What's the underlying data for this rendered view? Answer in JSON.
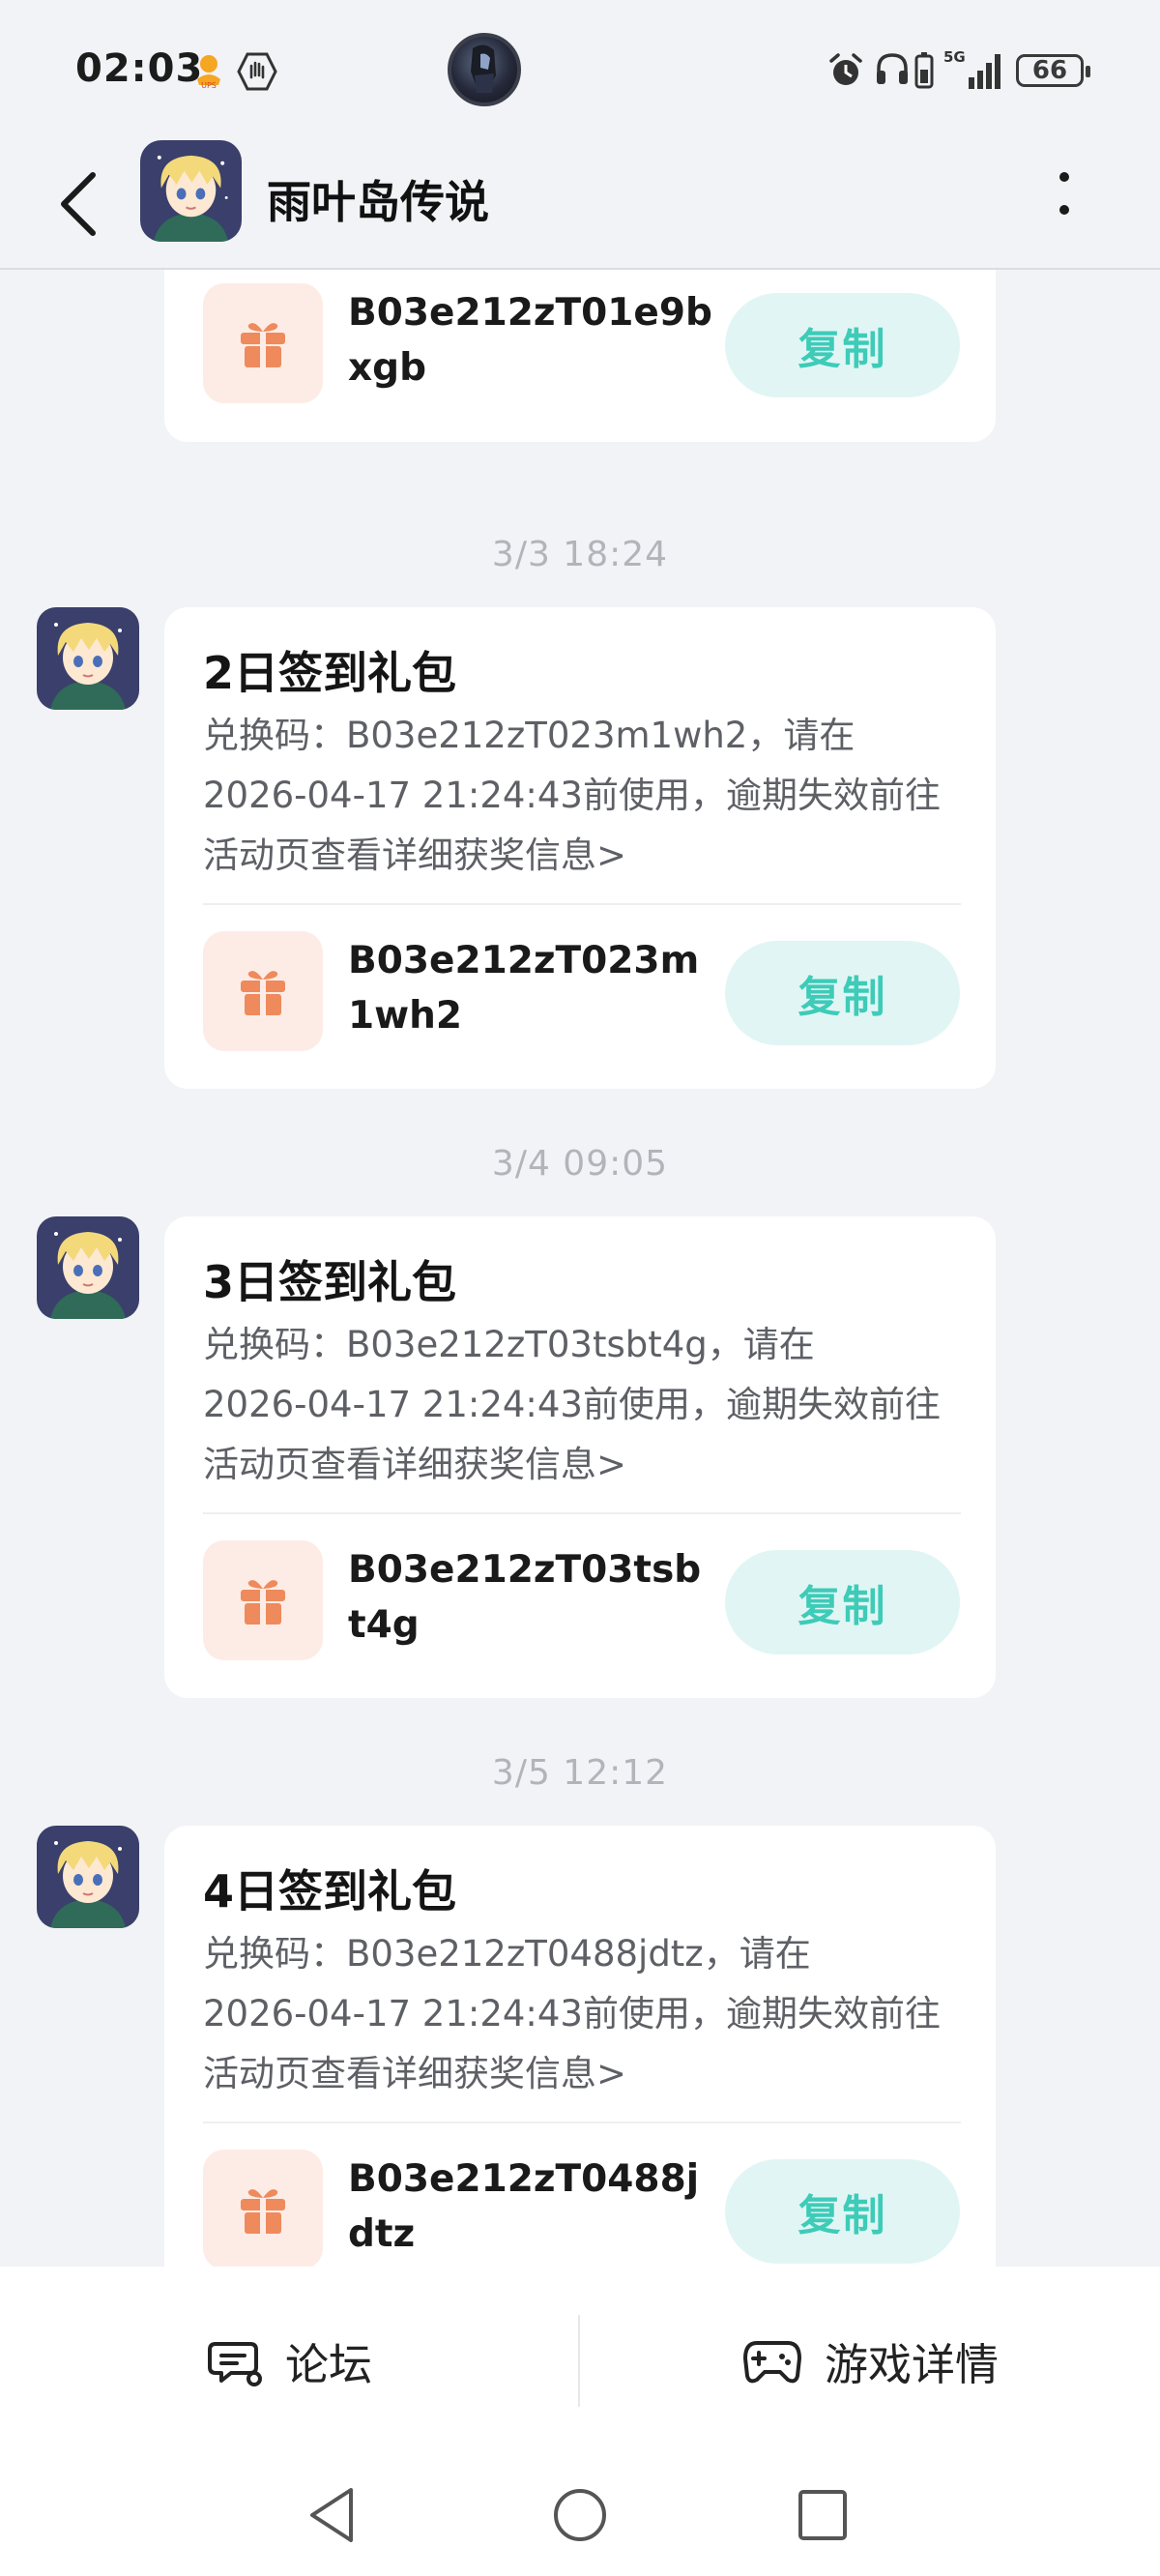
{
  "status": {
    "time": "02:03",
    "battery": "66",
    "network": "5G"
  },
  "header": {
    "title": "雨叶岛传说"
  },
  "first_card": {
    "code": "B03e212zT01e9bxgb",
    "copy_label": "复制"
  },
  "messages": [
    {
      "timestamp": "3/3  18:24",
      "title": "2日签到礼包",
      "desc_prefix": "兑换码：B03e212zT023m1wh2，请在",
      "desc_line2": "2026-04-17 21:24:43前使用，逾期失效前往",
      "desc_line3": "活动页查看详细获奖信息>",
      "code": "B03e212zT023m1wh2",
      "copy_label": "复制"
    },
    {
      "timestamp": "3/4  09:05",
      "title": "3日签到礼包",
      "desc_prefix": "兑换码：B03e212zT03tsbt4g，请在",
      "desc_line2": "2026-04-17 21:24:43前使用，逾期失效前往",
      "desc_line3": "活动页查看详细获奖信息>",
      "code": "B03e212zT03tsbt4g",
      "copy_label": "复制"
    },
    {
      "timestamp": "3/5  12:12",
      "title": "4日签到礼包",
      "desc_prefix": "兑换码：B03e212zT0488jdtz，请在",
      "desc_line2": "2026-04-17 21:24:43前使用，逾期失效前往",
      "desc_line3": "活动页查看详细获奖信息>",
      "code": "B03e212zT0488jdtz",
      "copy_label": "复制"
    }
  ],
  "bottom_bar": {
    "forum_label": "论坛",
    "game_detail_label": "游戏详情"
  },
  "colors": {
    "accent": "#3ecbb8",
    "copy_bg": "#e1f6f4",
    "gift": "#ef8a5c",
    "gift_bg": "#fdece6"
  },
  "icons": [
    "back-arrow-icon",
    "more-vertical-icon",
    "gift-icon",
    "forum-chat-icon",
    "gamepad-icon",
    "nav-back-icon",
    "nav-home-icon",
    "nav-recents-icon"
  ]
}
